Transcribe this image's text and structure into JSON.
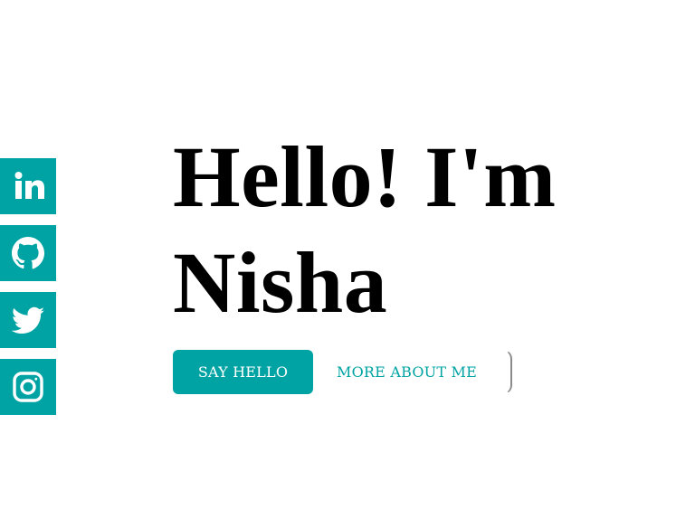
{
  "social": {
    "items": [
      {
        "name": "linkedin",
        "icon": "linkedin-icon"
      },
      {
        "name": "github",
        "icon": "github-icon"
      },
      {
        "name": "twitter",
        "icon": "twitter-icon"
      },
      {
        "name": "instagram",
        "icon": "instagram-icon"
      }
    ]
  },
  "hero": {
    "title": "Hello! I'm Nisha"
  },
  "actions": {
    "primary_label": "SAY HELLO",
    "secondary_label": "MORE ABOUT ME"
  },
  "colors": {
    "accent": "#00a3a3",
    "text": "#000000",
    "background": "#ffffff"
  }
}
